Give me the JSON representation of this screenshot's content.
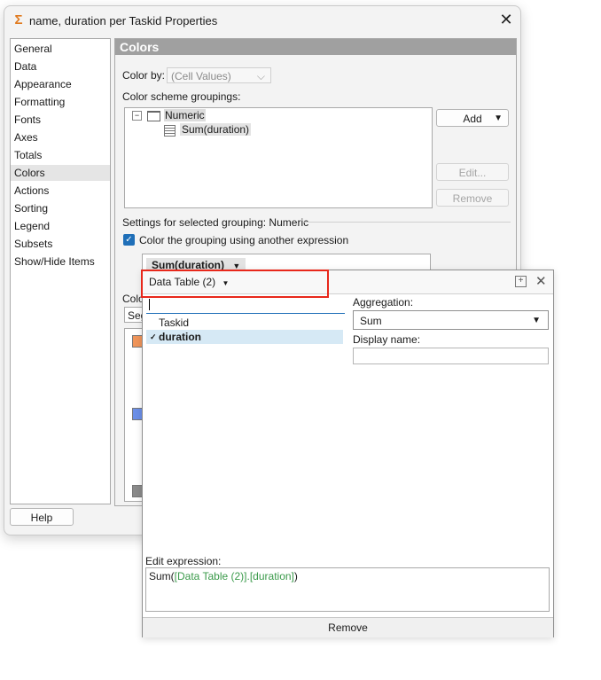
{
  "window": {
    "title": "name, duration per Taskid Properties",
    "close_glyph": "✕",
    "app_icon": "Σ"
  },
  "nav": {
    "items": [
      "General",
      "Data",
      "Appearance",
      "Formatting",
      "Fonts",
      "Axes",
      "Totals",
      "Colors",
      "Actions",
      "Sorting",
      "Legend",
      "Subsets",
      "Show/Hide Items"
    ],
    "selected": "Colors"
  },
  "help_button": "Help",
  "colors": {
    "header": "Colors",
    "color_by_label": "Color by:",
    "color_by_value": "(Cell Values)",
    "scheme_groupings_label": "Color scheme groupings:",
    "tree": {
      "folder": "Numeric",
      "child": "Sum(duration)"
    },
    "add_button": "Add",
    "edit_button": "Edit...",
    "remove_button": "Remove",
    "settings_label": "Settings for selected grouping: Numeric",
    "checkbox_label": "Color the grouping using another expression",
    "expression_pill": "Sum(duration)",
    "color_mode_label_partial": "Colo",
    "segment_label_partial": "Seg",
    "swatch_colors": [
      "#f0955a",
      "#6b8fe8",
      "#8a8a8a"
    ]
  },
  "popup": {
    "table_selector": "Data Table (2)",
    "search_value": "",
    "columns": [
      "Taskid",
      "duration"
    ],
    "selected_column": "duration",
    "aggregation_label": "Aggregation:",
    "aggregation_value": "Sum",
    "display_name_label": "Display name:",
    "display_name_value": "",
    "edit_expression_label": "Edit expression:",
    "expression": {
      "prefix": "Sum(",
      "table": "[Data Table (2)]",
      "dot": ".",
      "column": "[duration]",
      "suffix": ")"
    },
    "remove_label": "Remove"
  }
}
